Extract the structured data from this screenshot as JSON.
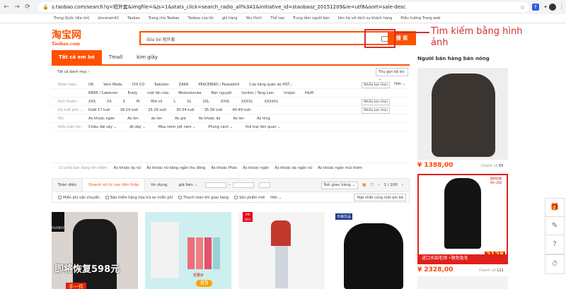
{
  "browser": {
    "url": "s.taobao.com/search?q=短外套&imgfile=&js=1&stats_click=search_radio_all%3A1&initiative_id=staobaoz_20151209&ie=utf8&sort=sale-desc",
    "back_icon": "←",
    "forward_icon": "→",
    "reload_icon": "⟳"
  },
  "bookmarks": [
    "Trung Quốc (địa chỉ)",
    "dovanam42",
    "Taobao",
    "Trang chủ Taobao",
    "Taobao của tôi",
    "giỏ hàng",
    "Yêu thích",
    "Thể loại",
    "Trung tâm người bán",
    "liên hệ với dịch vụ khách hàng",
    "Điều hướng Trang web"
  ],
  "logo": {
    "cn": "淘宝网",
    "en": "Taobao.com"
  },
  "search": {
    "query": "đứa bé  短外套",
    "button": "搜 索"
  },
  "annotation": {
    "text": "Tìm kiếm bằng hình ảnh"
  },
  "tabs": [
    "Tất cả em bé",
    "Tmall",
    "kim giây"
  ],
  "crumb": "Tất cả danh mục  ›",
  "sort_select": "Thu gọn bộ lọc ⌄",
  "filters": [
    {
      "label": "Nhãn hiệu:",
      "values": [
        "UR",
        "Vero Moda",
        "CHỈ CÓ",
        "Rakuten",
        "ZARA",
        "PEACEBIRD / Peacebird",
        "Cửa hàng quần áo HST..."
      ],
      "more": "Nhiều lựa chọn",
      "more2": "Hơn ⌄"
    },
    {
      "label": "",
      "values": [
        "KBNE / Caberner",
        "Evely",
        "một lần nữa",
        "Meterstonwe",
        "Bán nguyệt",
        "tonlion / Tang Lion",
        "Uniqlo",
        "H&M"
      ]
    },
    {
      "label": "kích thước:",
      "values": [
        "XXS",
        "XS",
        "S",
        "M",
        "Mới cỡ",
        "L",
        "XL",
        "2XL",
        "XXXL",
        "XXXXL",
        "XXXXXL"
      ],
      "more": "Nhiều lựa chọn"
    },
    {
      "label": "Độ tuổi phù ...:",
      "values": [
        "Dưới 17 tuổi",
        "18-24 tuổi",
        "25-29 tuổi",
        "30-34 tuổi",
        "35-39 tuổi",
        "40-49 tuổi"
      ],
      "more": "Nhiều lựa chọn"
    },
    {
      "label": "Nữ:",
      "values": [
        "Áo khoác ngắn",
        "Áo len",
        "áo len",
        "Áo gió",
        "Áo khoác da",
        "Áo len",
        "Áo lông"
      ]
    },
    {
      "label": "Điều kiện lọc:",
      "values": [
        "Chiều dài váy ⌄",
        "độ dày ⌄",
        "Mùa niêm yết năm ⌄",
        "Phong cách ⌄",
        "thể loại liên quan ⌄"
      ]
    }
  ],
  "related": {
    "label": "Có phải bạn đang tìm kiếm:",
    "items": [
      "Áo khoác dạ nữ",
      "Áo khoác nữ dáng ngắn thu đông",
      "Áo khoác Pháo",
      "Áo khoác ngắn",
      "Áo khoác dạ ngắn nữ",
      "Áo khoác ngắn mùi thơm"
    ]
  },
  "sortbar": {
    "items": [
      "Toàn diện",
      "Doanh số từ cao đến thấp",
      "tín dụng",
      "giá bán ⌄"
    ],
    "price_sep": "–",
    "shipping": "Nơi giao hàng ⌄",
    "page": "1 / 100",
    "prev": "‹",
    "next": "›"
  },
  "options": [
    "Miễn phí vận chuyển",
    "Bảo hiểm hàng hóa trả lại miễn phí",
    "Thanh toán khi giao hàng",
    "Sản phẩm mới",
    "Hơn ⌄"
  ],
  "compare": "Hợp nhất cùng một em bé",
  "products": [
    {
      "badge": "PLAYBOY",
      "caption": "即将恢复598元",
      "tag": "手一件"
    },
    {
      "caption": "",
      "tag": "89",
      "subtag": "优惠价"
    },
    {
      "badge": "UNI QLO",
      "caption": ""
    },
    {
      "badge": "日最优品",
      "caption": ""
    }
  ],
  "sidebar": {
    "title": "Người bán hàng bán nóng",
    "items": [
      {
        "price": "¥ 1388,00",
        "sold_label": "Doanh số",
        "sold": "65"
      },
      {
        "price": "¥ 2328,00",
        "sold_label": "Doanh số",
        "sold": "121",
        "banner": "进口水貂毛领 •限免兔毛",
        "promo": "限时优惠 90~200",
        "promo_price": "2128"
      }
    ]
  },
  "float_tools": [
    "🎁",
    "✎",
    "?",
    "⏱"
  ]
}
